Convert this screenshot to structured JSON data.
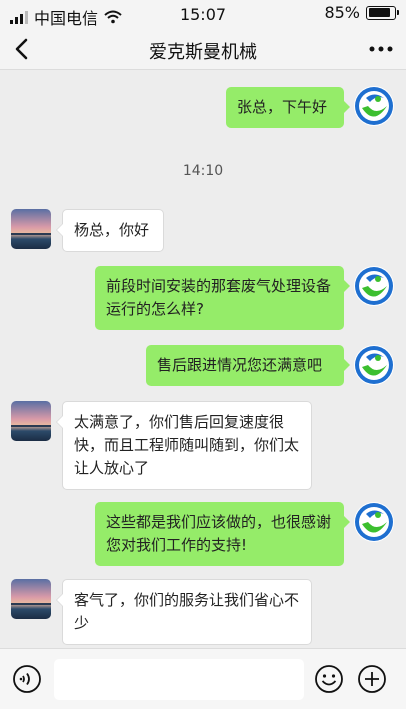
{
  "status_bar": {
    "carrier": "中国电信",
    "time": "15:07",
    "battery_percent": "85%",
    "battery_level": 0.85
  },
  "nav": {
    "title": "爱克斯曼机械",
    "back_icon": "chevron-left-icon",
    "more_icon": "more-dots-icon"
  },
  "chat": {
    "timestamp": "14:10",
    "messages": [
      {
        "side": "out",
        "text": "张总，下午好"
      },
      {
        "side": "in",
        "text": "杨总，你好"
      },
      {
        "side": "out",
        "text": "前段时间安装的那套废气处理设备运行的怎么样?"
      },
      {
        "side": "out",
        "text": "售后跟进情况您还满意吧"
      },
      {
        "side": "in",
        "text": "太满意了，你们售后回复速度很快，而且工程师随叫随到，你们太让人放心了"
      },
      {
        "side": "out",
        "text": "这些都是我们应该做的，也很感谢您对我们工作的支持!"
      },
      {
        "side": "in",
        "text": "客气了，你们的服务让我们省心不少"
      }
    ]
  },
  "input_bar": {
    "value": "",
    "voice_icon": "voice-icon",
    "emoji_icon": "emoji-icon",
    "plus_icon": "plus-icon"
  },
  "colors": {
    "outgoing_bubble": "#95ec69",
    "incoming_bubble": "#ffffff",
    "background": "#ededed"
  }
}
